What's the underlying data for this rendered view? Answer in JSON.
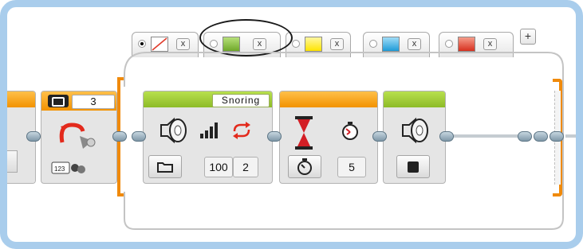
{
  "tabs": [
    {
      "color": "none",
      "selected": true,
      "close": "x"
    },
    {
      "color": "#8dc63f",
      "selected": false,
      "close": "x"
    },
    {
      "color": "#ffe800",
      "selected": false,
      "close": "x"
    },
    {
      "color": "#2aaae2",
      "selected": false,
      "close": "x"
    },
    {
      "color": "#e03a2a",
      "selected": false,
      "close": "x"
    }
  ],
  "add_tab_label": "+",
  "loop_block": {
    "count": "3"
  },
  "sound_block": {
    "name": "Snoring",
    "volume": "100",
    "play_type": "2"
  },
  "wait_block": {
    "seconds": "5"
  },
  "colors": {
    "sequence_orange": "#f08a0b",
    "action_green": "#8dbb27",
    "flow_orange": "#f29200",
    "frame_blue": "#a9cdec"
  }
}
